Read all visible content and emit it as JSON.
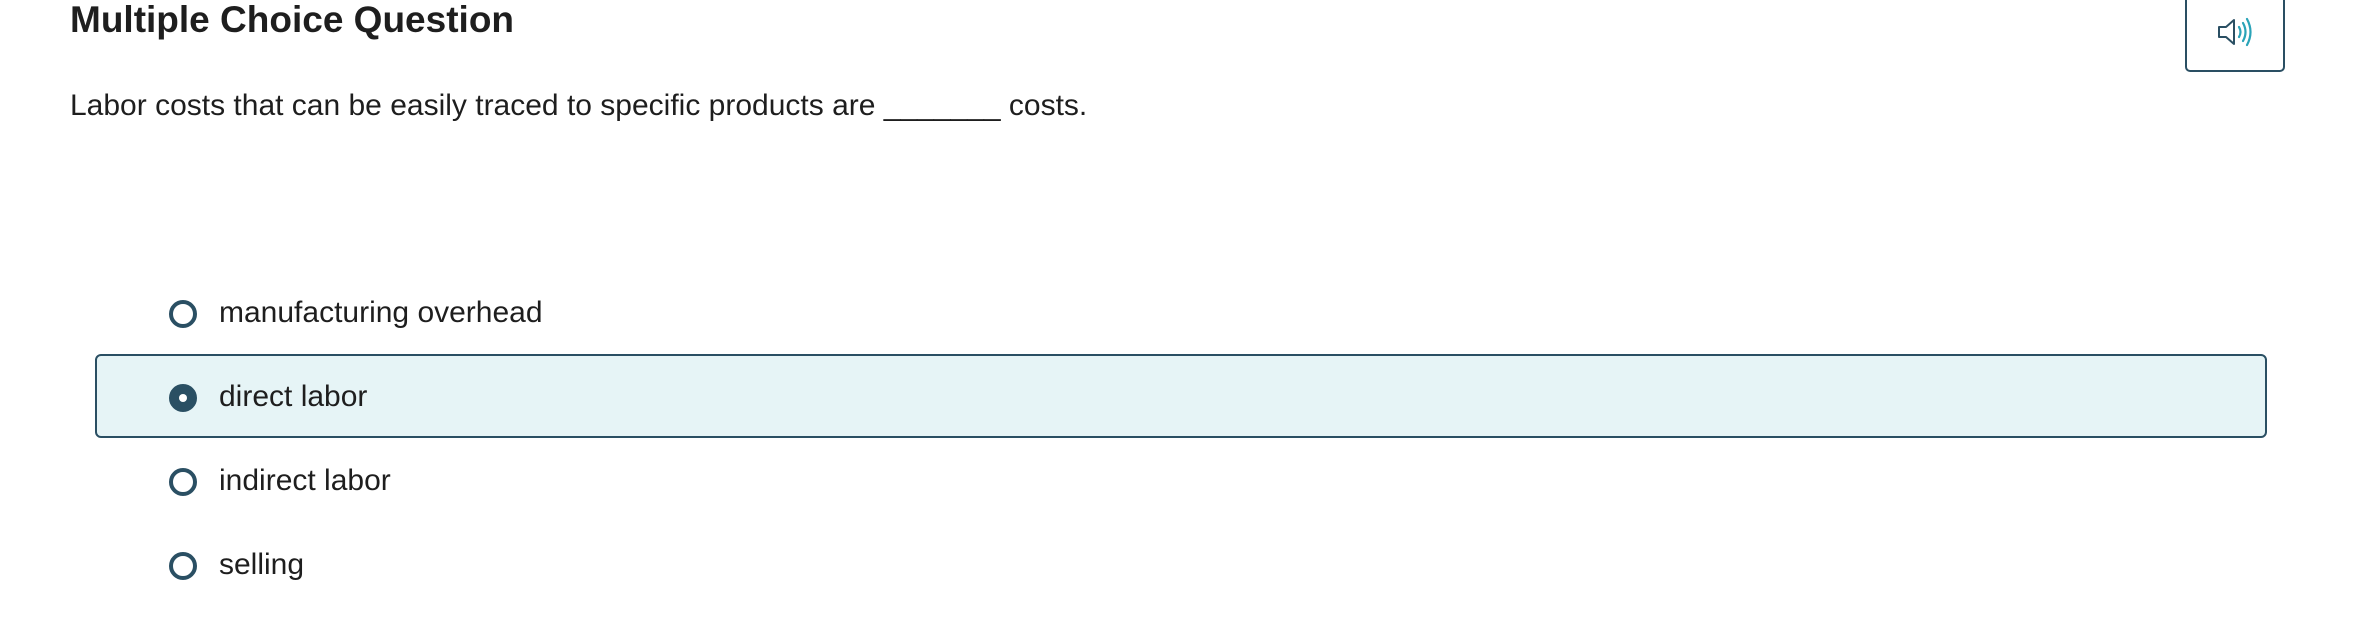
{
  "question": {
    "title": "Multiple Choice Question",
    "prompt": "Labor costs that can be easily traced to specific products are _______ costs."
  },
  "audio_button": {
    "icon": "speaker-icon",
    "accent_color": "#2aa3b8"
  },
  "choices": [
    {
      "label": "manufacturing overhead",
      "selected": false
    },
    {
      "label": "direct labor",
      "selected": true
    },
    {
      "label": "indirect labor",
      "selected": false
    },
    {
      "label": "selling",
      "selected": false
    }
  ],
  "colors": {
    "border": "#2a4f63",
    "selected_background": "#e6f4f6"
  }
}
